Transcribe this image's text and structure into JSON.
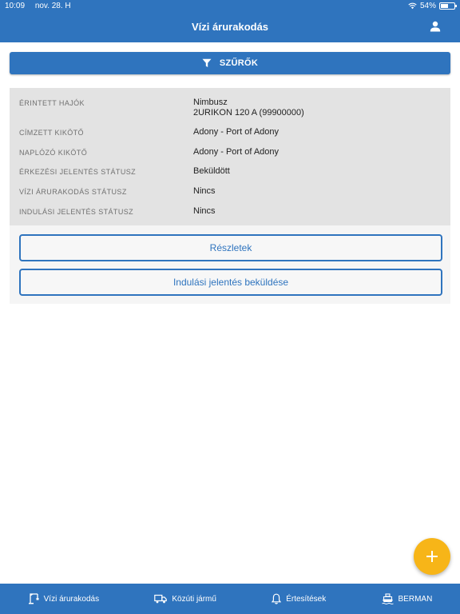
{
  "status_bar": {
    "time": "10:09",
    "date": "nov. 28. H",
    "battery_percent_label": "54%",
    "battery_level": 0.54
  },
  "header": {
    "title": "Vízi árurakodás"
  },
  "filter_button": {
    "label": "SZŰRŐK"
  },
  "record": {
    "fields": [
      {
        "label": "ÉRINTETT HAJÓK",
        "value": "Nimbusz",
        "value2": "2URIKON 120 A (99900000)"
      },
      {
        "label": "CÍMZETT KIKÖTŐ",
        "value": "Adony - Port of Adony"
      },
      {
        "label": "NAPLÓZÓ KIKÖTŐ",
        "value": "Adony - Port of Adony"
      },
      {
        "label": "ÉRKEZÉSI JELENTÉS STÁTUSZ",
        "value": "Beküldött"
      },
      {
        "label": "VÍZI ÁRURAKODÁS STÁTUSZ",
        "value": "Nincs"
      },
      {
        "label": "INDULÁSI JELENTÉS STÁTUSZ",
        "value": "Nincs"
      }
    ],
    "buttons": {
      "details": "Részletek",
      "send_departure": "Indulási jelentés beküldése"
    }
  },
  "tabbar": {
    "tabs": [
      {
        "label": "Vízi árurakodás",
        "icon": "crane-icon"
      },
      {
        "label": "Közúti jármű",
        "icon": "truck-icon"
      },
      {
        "label": "Értesítések",
        "icon": "bell-icon"
      },
      {
        "label": "BERMAN",
        "icon": "ship-icon"
      }
    ]
  },
  "colors": {
    "primary": "#2f74be",
    "fab": "#f7b518",
    "info_background": "#e3e3e3"
  }
}
